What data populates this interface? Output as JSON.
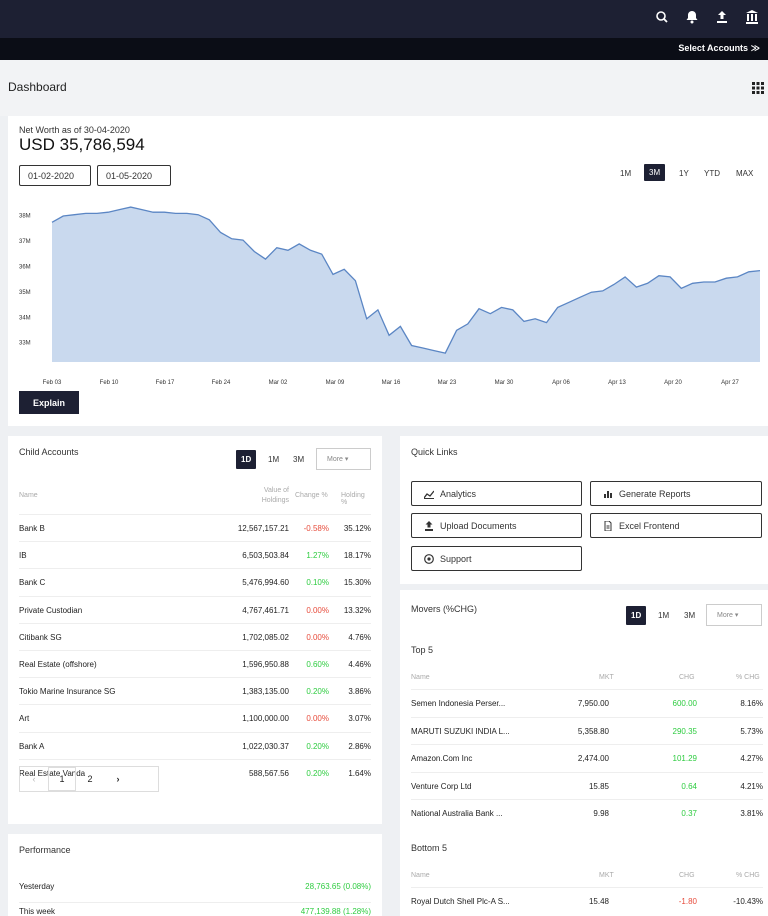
{
  "header": {
    "select_accounts": "Select Accounts ≫"
  },
  "page": {
    "title": "Dashboard"
  },
  "networth": {
    "label": "Net Worth as of 30-04-2020",
    "value": "USD 35,786,594",
    "from_date": "01-02-2020",
    "to_date": "01-05-2020",
    "ranges": [
      "1M",
      "3M",
      "1Y",
      "YTD",
      "MAX"
    ],
    "active_range": "3M",
    "explain_label": "Explain"
  },
  "chart_data": {
    "type": "area",
    "y_ticks": [
      "38M",
      "37M",
      "36M",
      "35M",
      "34M",
      "33M"
    ],
    "x_ticks": [
      "Feb 03",
      "Feb 10",
      "Feb 17",
      "Feb 24",
      "Mar 02",
      "Mar 09",
      "Mar 16",
      "Mar 23",
      "Mar 30",
      "Apr 06",
      "Apr 13",
      "Apr 20",
      "Apr 27"
    ],
    "ylim": [
      32.2,
      38.5
    ],
    "grid": false,
    "color": "#c9d9ee",
    "line_color": "#5b86c4",
    "values": [
      37.7,
      37.95,
      38.0,
      38.05,
      38.05,
      38.1,
      38.2,
      38.3,
      38.2,
      38.1,
      38.1,
      38.05,
      38.05,
      38.0,
      37.8,
      37.3,
      37.05,
      37.0,
      36.55,
      36.25,
      36.7,
      36.6,
      36.85,
      36.6,
      36.45,
      35.65,
      35.85,
      35.4,
      33.9,
      34.25,
      33.25,
      33.6,
      32.85,
      32.75,
      32.65,
      32.55,
      33.45,
      33.7,
      34.3,
      34.1,
      34.35,
      34.25,
      33.8,
      33.9,
      33.75,
      34.35,
      34.55,
      34.75,
      34.95,
      35.0,
      35.25,
      35.55,
      35.15,
      35.3,
      35.6,
      35.55,
      35.1,
      35.3,
      35.35,
      35.35,
      35.5,
      35.55,
      35.75,
      35.8
    ]
  },
  "child_accounts": {
    "title": "Child Accounts",
    "periods": [
      "1D",
      "1M",
      "3M"
    ],
    "more_label": "More ▾",
    "headers": {
      "name": "Name",
      "value": "Value of Holdings",
      "change": "Change %",
      "holding": "Holding %"
    },
    "rows": [
      {
        "name": "Bank B",
        "value": "12,567,157.21",
        "change": "-0.58%",
        "holding": "35.12%",
        "cls": "neg"
      },
      {
        "name": "IB",
        "value": "6,503,503.84",
        "change": "1.27%",
        "holding": "18.17%",
        "cls": "pos"
      },
      {
        "name": "Bank C",
        "value": "5,476,994.60",
        "change": "0.10%",
        "holding": "15.30%",
        "cls": "pos"
      },
      {
        "name": "Private Custodian",
        "value": "4,767,461.71",
        "change": "0.00%",
        "holding": "13.32%",
        "cls": "zero"
      },
      {
        "name": "Citibank SG",
        "value": "1,702,085.02",
        "change": "0.00%",
        "holding": "4.76%",
        "cls": "zero"
      },
      {
        "name": "Real Estate (offshore)",
        "value": "1,596,950.88",
        "change": "0.60%",
        "holding": "4.46%",
        "cls": "pos"
      },
      {
        "name": "Tokio Marine Insurance SG",
        "value": "1,383,135.00",
        "change": "0.20%",
        "holding": "3.86%",
        "cls": "pos"
      },
      {
        "name": "Art",
        "value": "1,100,000.00",
        "change": "0.00%",
        "holding": "3.07%",
        "cls": "zero"
      },
      {
        "name": "Bank A",
        "value": "1,022,030.37",
        "change": "0.20%",
        "holding": "2.86%",
        "cls": "pos"
      },
      {
        "name": "Real Estate Vanda",
        "value": "588,567.56",
        "change": "0.20%",
        "holding": "1.64%",
        "cls": "pos"
      }
    ],
    "pages": [
      "1",
      "2"
    ]
  },
  "quick_links": {
    "title": "Quick Links",
    "links": [
      "Analytics",
      "Generate Reports",
      "Upload Documents",
      "Excel Frontend",
      "Support"
    ]
  },
  "movers": {
    "title": "Movers (%CHG)",
    "periods": [
      "1D",
      "1M",
      "3M"
    ],
    "more_label": "More ▾",
    "top_label": "Top 5",
    "bottom_label": "Bottom 5",
    "headers": {
      "name": "Name",
      "mkt": "MKT",
      "chg": "CHG",
      "pct": "% CHG"
    },
    "top": [
      {
        "name": "Semen Indonesia Perser...",
        "mkt": "7,950.00",
        "chg": "600.00",
        "pct": "8.16%"
      },
      {
        "name": "MARUTI SUZUKI INDIA L...",
        "mkt": "5,358.80",
        "chg": "290.35",
        "pct": "5.73%"
      },
      {
        "name": "Amazon.Com Inc",
        "mkt": "2,474.00",
        "chg": "101.29",
        "pct": "4.27%"
      },
      {
        "name": "Venture Corp Ltd",
        "mkt": "15.85",
        "chg": "0.64",
        "pct": "4.21%"
      },
      {
        "name": "National Australia Bank ...",
        "mkt": "9.98",
        "chg": "0.37",
        "pct": "3.81%"
      }
    ],
    "bottom": [
      {
        "name": "Royal Dutch Shell Plc-A S...",
        "mkt": "15.48",
        "chg": "-1.80",
        "pct": "-10.43%"
      }
    ]
  },
  "performance": {
    "title": "Performance",
    "rows": [
      {
        "label": "Yesterday",
        "value": "28,763.65 (0.08%)"
      },
      {
        "label": "This week",
        "value": "477,139.88 (1.28%)"
      }
    ]
  }
}
